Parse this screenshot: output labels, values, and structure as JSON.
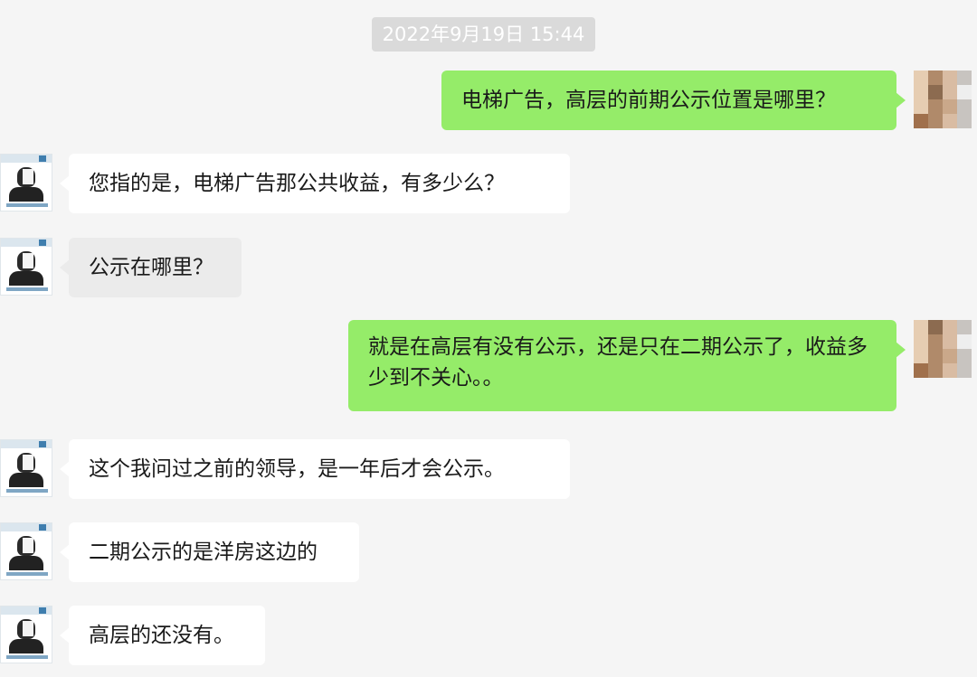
{
  "chat": {
    "timestamp": "2022年9月19日 15:44",
    "messages": [
      {
        "sender": "me",
        "text": "电梯广告，高层的前期公示位置是哪里？"
      },
      {
        "sender": "them",
        "text": "您指的是，电梯广告那公共收益，有多少么？"
      },
      {
        "sender": "them",
        "text": "公示在哪里？"
      },
      {
        "sender": "me",
        "text": "就是在高层有没有公示，还是只在二期公示了，收益多少到不关心。。"
      },
      {
        "sender": "them",
        "text": "这个我问过之前的领导，是一年后才会公示。"
      },
      {
        "sender": "them",
        "text": "二期公示的是洋房这边的"
      },
      {
        "sender": "them",
        "text": "高层的还没有。"
      }
    ]
  },
  "colors": {
    "background": "#f5f5f5",
    "my_bubble": "#95ec69",
    "their_bubble": "#ffffff",
    "timestamp_bg": "#dadada"
  }
}
